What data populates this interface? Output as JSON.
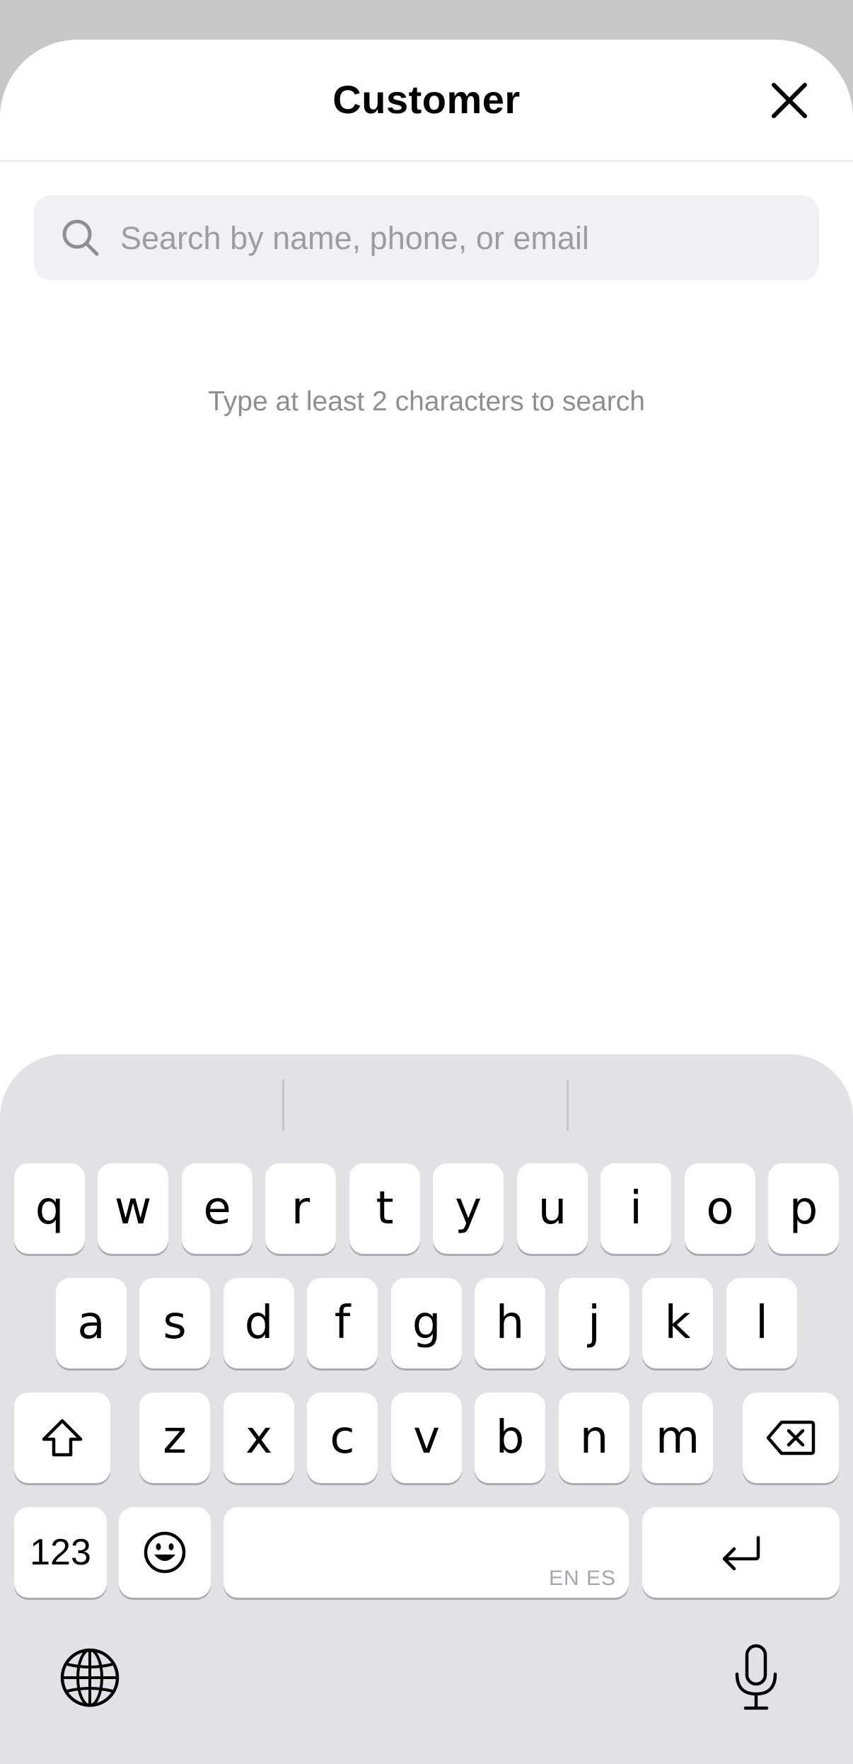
{
  "sheet": {
    "title": "Customer",
    "close_icon": "close-icon"
  },
  "search": {
    "placeholder": "Search by name, phone, or email",
    "value": "",
    "icon": "search-icon"
  },
  "hint": "Type at least 2 characters to search",
  "keyboard": {
    "row1": [
      "q",
      "w",
      "e",
      "r",
      "t",
      "y",
      "u",
      "i",
      "o",
      "p"
    ],
    "row2": [
      "a",
      "s",
      "d",
      "f",
      "g",
      "h",
      "j",
      "k",
      "l"
    ],
    "row3": [
      "z",
      "x",
      "c",
      "v",
      "b",
      "n",
      "m"
    ],
    "numbers_key": "123",
    "space_lang": "EN ES",
    "icons": {
      "shift": "shift-icon",
      "delete": "backspace-icon",
      "emoji": "emoji-icon",
      "return": "return-icon",
      "globe": "globe-icon",
      "mic": "microphone-icon"
    }
  }
}
